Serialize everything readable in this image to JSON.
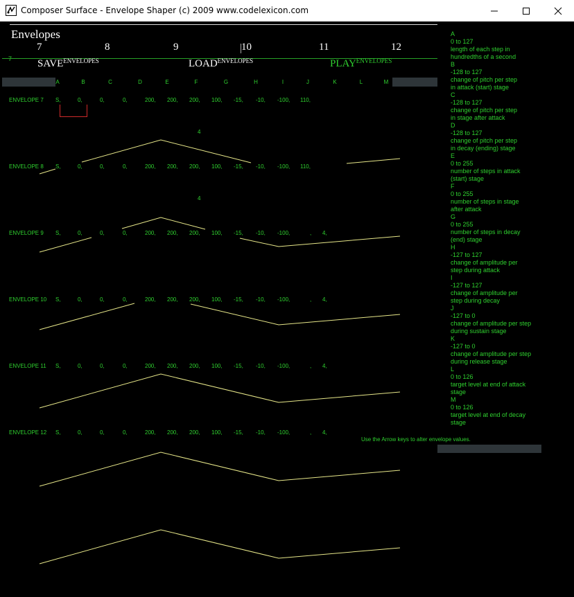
{
  "window": {
    "title": "Composer Surface - Envelope Shaper (c) 2009 www.codelexicon.com",
    "icon": "composer-app-icon",
    "controls": [
      "minimize-icon",
      "maximize-icon",
      "close-icon"
    ]
  },
  "header": {
    "section_title": "Envelopes",
    "numbers": [
      "7",
      "8",
      "9",
      "10",
      "11",
      "12"
    ],
    "small_seven": "7",
    "actions": [
      {
        "big": "SAVE",
        "small": "ENVELOPES",
        "color": "#ffffff"
      },
      {
        "big": "LOAD",
        "small": "ENVELOPES",
        "color": "#ffffff"
      },
      {
        "big": "PLAY",
        "small": "ENVELOPES",
        "color": "#2fd02f"
      }
    ]
  },
  "columns": [
    "A",
    "B",
    "C",
    "D",
    "E",
    "F",
    "G",
    "H",
    "I",
    "J",
    "K",
    "L",
    "M"
  ],
  "envelopes": [
    {
      "label": "ENVELOPE 7",
      "values": [
        "S,",
        "0,",
        "0,",
        "0,",
        "200,",
        "200,",
        "200,",
        "100,",
        "-15,",
        "-10,",
        "-100,",
        "110,"
      ]
    },
    {
      "label": "ENVELOPE 8",
      "values": [
        "S,",
        "0,",
        "0,",
        "0,",
        "200,",
        "200,",
        "200,",
        "100,",
        "-15,",
        "-10,",
        "-100,",
        "110,"
      ]
    },
    {
      "label": "ENVELOPE 9",
      "values": [
        "S,",
        "0,",
        "0,",
        "0,",
        "200,",
        "200,",
        "200,",
        "100,",
        "-15,",
        "-10,",
        "-100,",
        ",",
        "4,"
      ]
    },
    {
      "label": "ENVELOPE 10",
      "values": [
        "S,",
        "0,",
        "0,",
        "0,",
        "200,",
        "200,",
        "200,",
        "100,",
        "-15,",
        "-10,",
        "-100,",
        ",",
        "4,"
      ]
    },
    {
      "label": "ENVELOPE 11",
      "values": [
        "S,",
        "0,",
        "0,",
        "0,",
        "200,",
        "200,",
        "200,",
        "100,",
        "-15,",
        "-10,",
        "-100,",
        ",",
        "4,"
      ]
    },
    {
      "label": "ENVELOPE 12",
      "values": [
        "S,",
        "0,",
        "0,",
        "0,",
        "200,",
        "200,",
        "200,",
        "100,",
        "-15,",
        "-10,",
        "-100,",
        ",",
        "4,"
      ]
    }
  ],
  "floating_values": [
    "4",
    "4"
  ],
  "help": [
    "A",
    "0 to 127",
    "length of each step in",
    "hundredths of a second",
    "B",
    "-128 to 127",
    "change of pitch per step",
    "in attack (start) stage",
    "C",
    "-128 to 127",
    "change of pitch per step",
    "in stage after attack",
    "D",
    "-128 to 127",
    "change of pitch per step",
    "in decay (ending) stage",
    "E",
    "0 to 255",
    "number of steps in attack",
    "(start) stage",
    "F",
    "0 to 255",
    "number of steps in stage",
    "after attack",
    "G",
    "0 to 255",
    "number of steps in decay",
    "(end) stage",
    "H",
    "-127 to 127",
    "change of amplitude per",
    "step during attack",
    "I",
    "-127 to 127",
    "change of amplitude per",
    "step during decay",
    "J",
    "-127 to 0",
    "change of amplitude per step",
    "during sustain stage",
    "K",
    "-127 to 0",
    "change of amplitude per step",
    "during release stage",
    "L",
    "0 to 126",
    "target level at end of attack",
    "stage",
    "M",
    "0 to 126",
    "target level at end of decay",
    "stage"
  ],
  "hint": "Use the Arrow keys to alter envelope values.",
  "colors": {
    "text": "#2fd02f",
    "curve": "#e8e88a",
    "selection": "#d12a2a",
    "bar": "#2e3539"
  }
}
